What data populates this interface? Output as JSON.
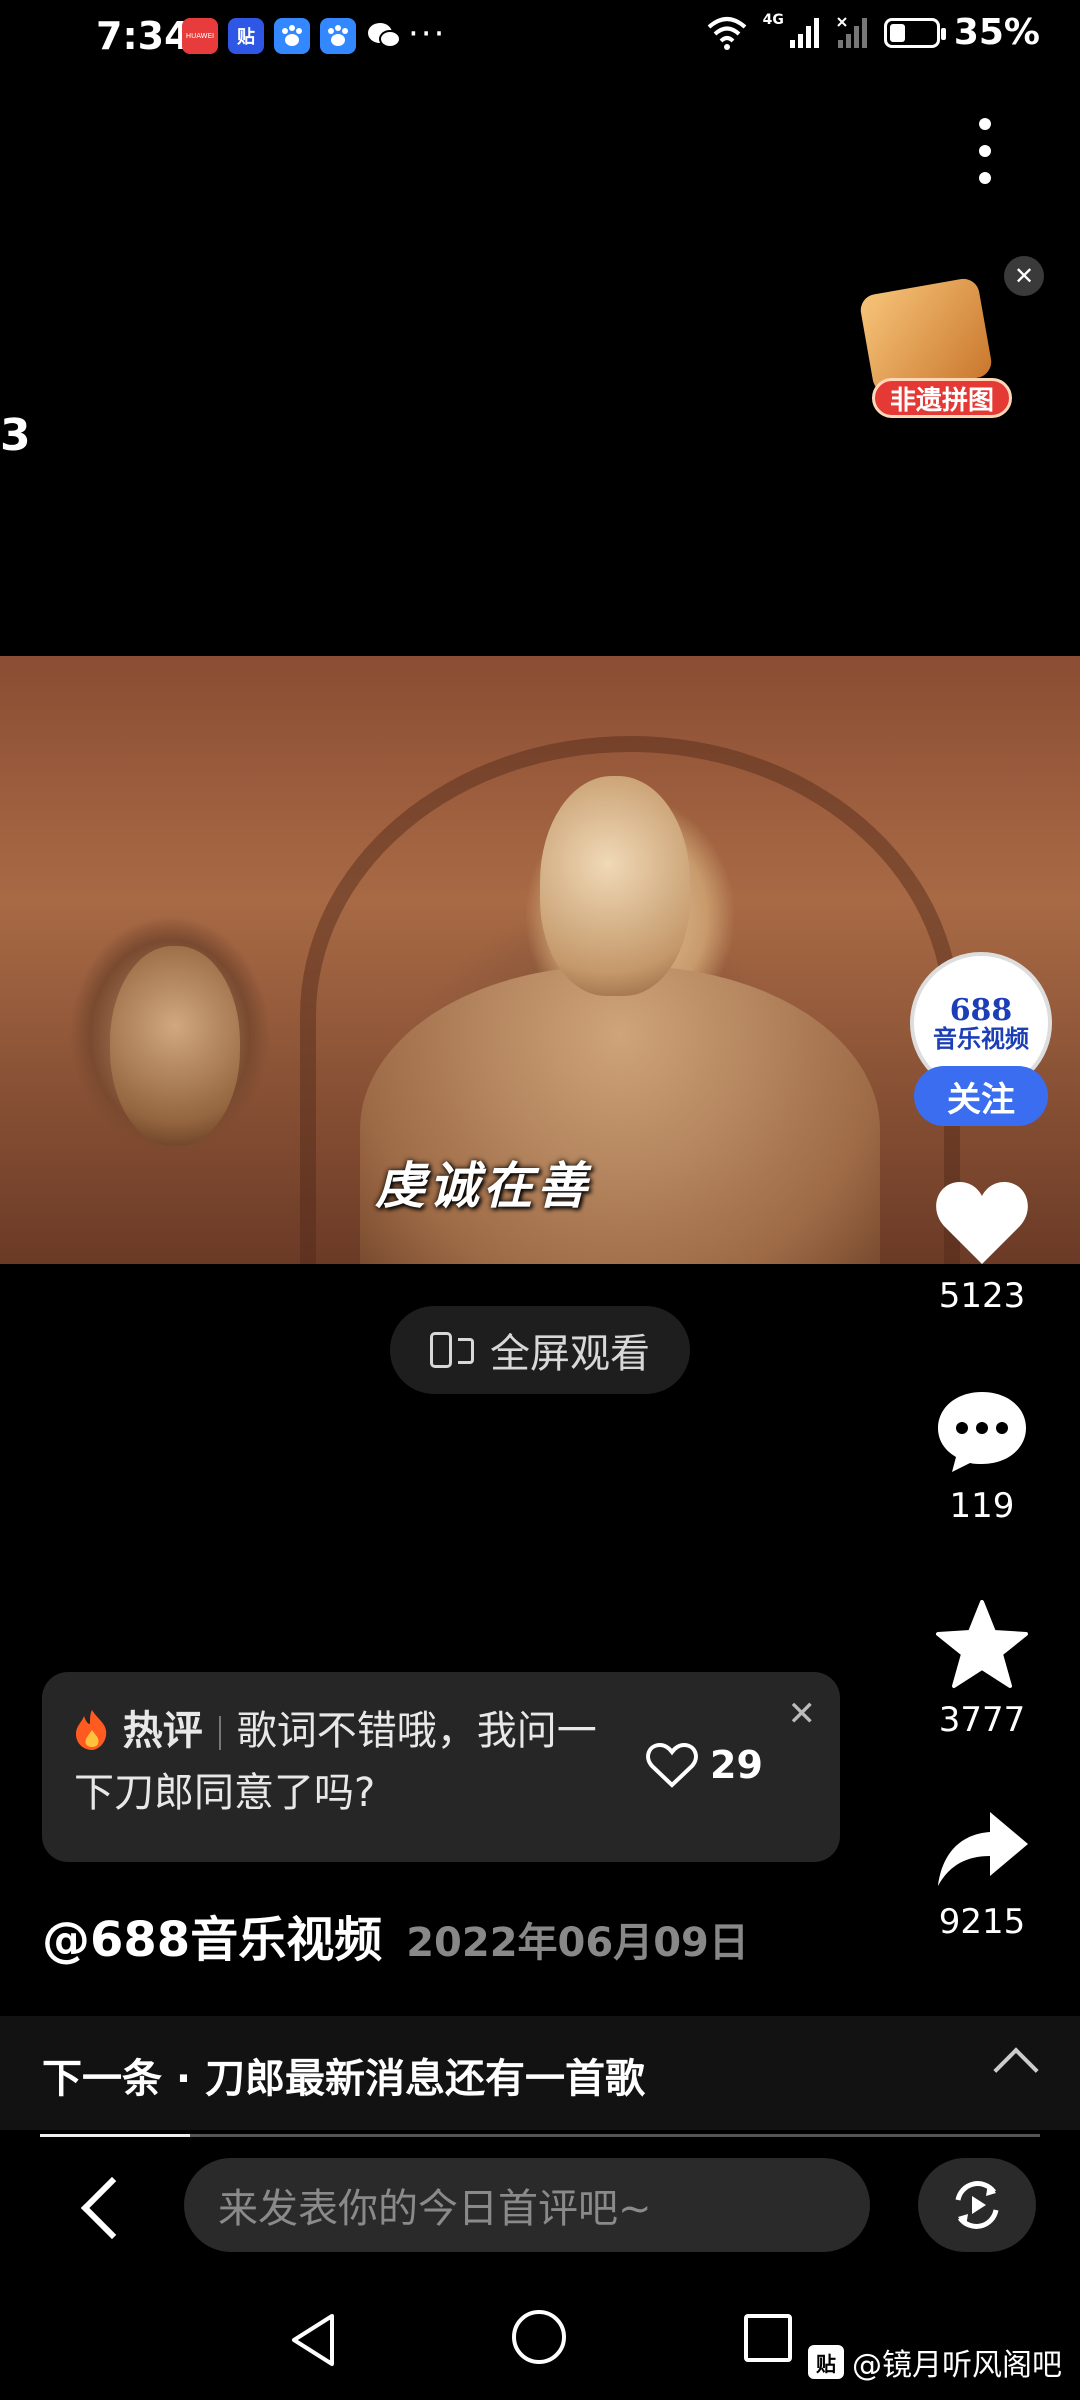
{
  "status_bar": {
    "time": "7:34",
    "apps": [
      "huawei-icon",
      "tieba-icon",
      "baidu-icon",
      "baidu-icon",
      "wechat-icon"
    ],
    "huawei_label": "HUAWEI",
    "tieba_label": "贴",
    "more": "···",
    "network": "4G",
    "battery_percent": "35%",
    "battery_level": 0.35
  },
  "promo": {
    "label": "非遗拼图",
    "close": "✕"
  },
  "edge_number": "3",
  "video": {
    "caption": "虔诚在善"
  },
  "fullscreen": {
    "label": "全屏观看"
  },
  "author": {
    "avatar_line1": "688",
    "avatar_line2": "音乐视频",
    "follow": "关注",
    "handle": "@688音乐视频",
    "date": "2022年06月09日"
  },
  "actions": {
    "likes": "5123",
    "comments": "119",
    "favorites": "3777",
    "shares": "9215"
  },
  "hot_comment": {
    "tag": "热评",
    "text": "歌词不错哦，我问一下刀郎同意了吗?",
    "likes": "29",
    "close": "✕"
  },
  "next": {
    "label": "下一条 · 刀郎最新消息还有一首歌",
    "progress": 0.15
  },
  "comment_input": {
    "placeholder": "来发表你的今日首评吧~"
  },
  "watermark": {
    "icon_text": "贴",
    "text": "@镜月听风阁吧"
  },
  "colors": {
    "background": "#000000",
    "follow_button": "#3a6df0",
    "promo_label": "#e53935",
    "date_text": "#888888"
  }
}
